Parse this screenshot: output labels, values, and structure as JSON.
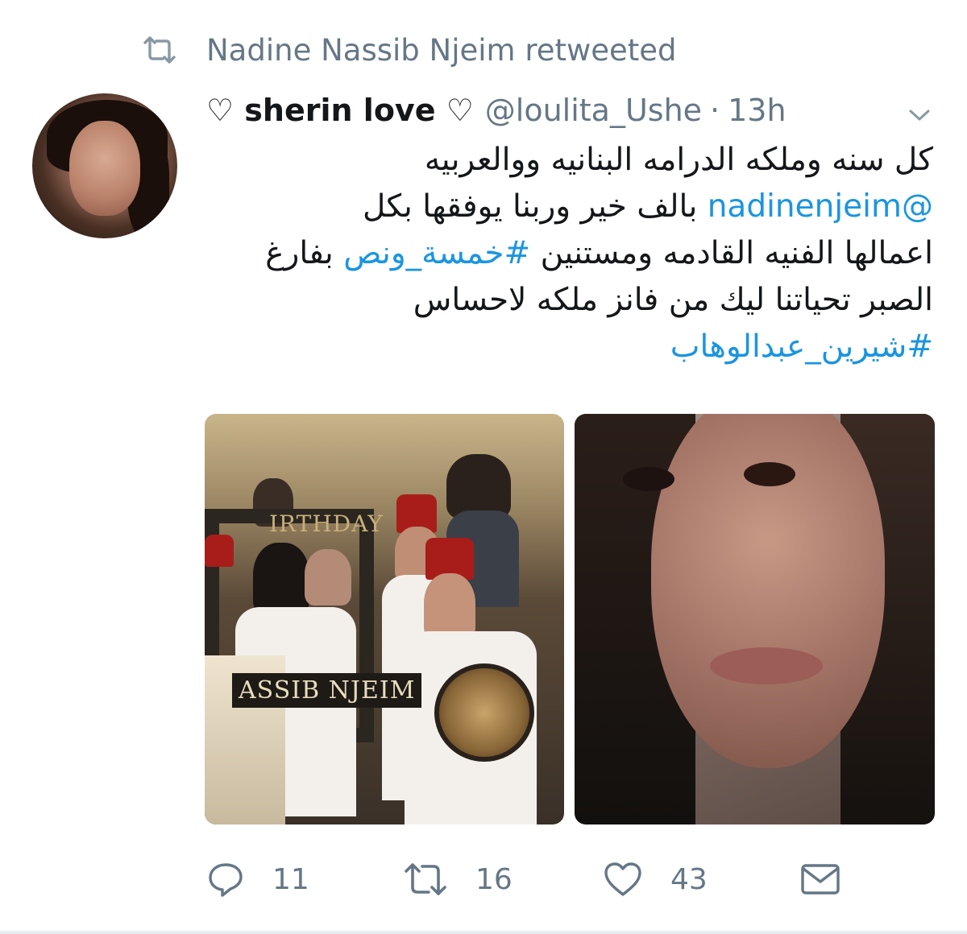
{
  "retweet_context": {
    "icon": "retweet-icon",
    "text": "Nadine Nassib Njeim retweeted"
  },
  "tweet": {
    "display_name": "♡ sherin love ♡",
    "handle": "@loulita_Ushe",
    "separator": "·",
    "time": "13h",
    "text_lines": {
      "l1": "كل سنه وملكه الدرامه البنانيه ووالعربيه",
      "l2_mention": "@nadinenjeim",
      "l2_rest": "بالف خير وربنا يوفقها بكل",
      "l3_a": "اعمالها الفنيه القادمه ومستنين",
      "l3_hashtag": "#خمسة_ونص",
      "l3_b": "بفارغ",
      "l4": "الصبر تحياتنا ليك من فانز ملكه لاحساس",
      "l5_hashtag": "#شيرين_عبدالوهاب"
    },
    "media": {
      "left_photo_text_top": "IRTHDAY",
      "left_photo_text_bottom": "ASSIB NJEIM"
    },
    "actions": {
      "reply_count": "11",
      "retweet_count": "16",
      "like_count": "43"
    }
  },
  "colors": {
    "link": "#1b95e0",
    "muted": "#657786",
    "text": "#14171a"
  }
}
